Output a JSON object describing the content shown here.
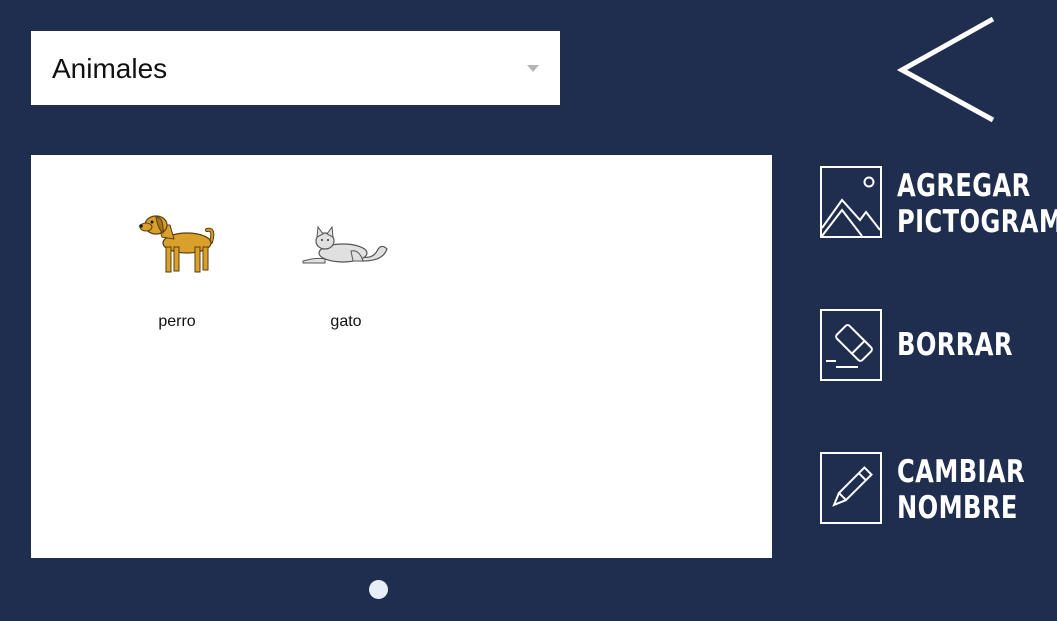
{
  "category": {
    "selected": "Animales"
  },
  "pictograms": [
    {
      "label": "perro",
      "icon": "dog-icon"
    },
    {
      "label": "gato",
      "icon": "cat-icon"
    }
  ],
  "actions": {
    "add": {
      "line1": "AGREGAR",
      "line2": "PICTOGRAMA",
      "icon": "image-icon"
    },
    "delete": {
      "line1": "BORRAR",
      "icon": "eraser-icon"
    },
    "rename": {
      "line1": "CAMBIAR",
      "line2": "NOMBRE",
      "icon": "pencil-icon"
    }
  },
  "pagination": {
    "current_page": 1,
    "total_pages": 1
  },
  "colors": {
    "background": "#1f2d4f",
    "panel": "#ffffff",
    "text_on_dark": "#ffffff",
    "dot": "#e6eef8",
    "dog": "#d9a12b",
    "cat": "#e0e0e0"
  }
}
